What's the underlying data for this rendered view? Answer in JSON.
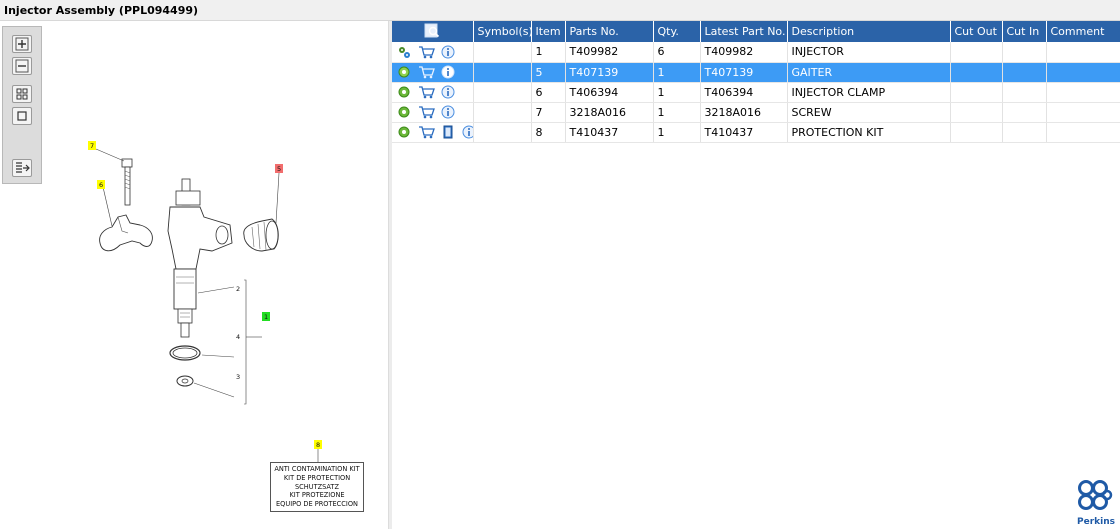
{
  "title": "Injector Assembly (PPL094499)",
  "toolbar": {
    "zoom_in": "zoom-in-icon",
    "zoom_out": "zoom-out-icon",
    "fit_all": "fit-all-icon",
    "actual_size": "actual-size-icon",
    "list_export": "list-export-icon"
  },
  "drawing": {
    "callouts": {
      "c7": "7",
      "c6": "6",
      "c5": "5",
      "c1": "1",
      "c2": "2",
      "c4": "4",
      "c3": "3",
      "c8": "8"
    },
    "kit_label": [
      "ANTI CONTAMINATION KIT",
      "KIT DE PROTECTION",
      "SCHUTZSATZ",
      "KIT PROTEZIONE",
      "EQUIPO DE PROTECCION"
    ]
  },
  "table": {
    "columns": {
      "icon": "search-list-icon",
      "symbols": "Symbol(s)",
      "item": "Item",
      "parts_no": "Parts No.",
      "qty": "Qty.",
      "latest_part_no": "Latest Part No.",
      "description": "Description",
      "cut_out": "Cut Out",
      "cut_in": "Cut In",
      "comment": "Comment"
    },
    "rows": [
      {
        "item": "1",
        "parts_no": "T409982",
        "qty": "6",
        "latest_part_no": "T409982",
        "description": "INJECTOR",
        "cut_out": "",
        "cut_in": "",
        "comment": "",
        "symbols": "",
        "icons": [
          "gears-icon",
          "cart-icon",
          "info-icon"
        ]
      },
      {
        "item": "5",
        "parts_no": "T407139",
        "qty": "1",
        "latest_part_no": "T407139",
        "description": "GAITER",
        "cut_out": "",
        "cut_in": "",
        "comment": "",
        "symbols": "",
        "icons": [
          "gear-icon",
          "cart-icon",
          "info-icon"
        ]
      },
      {
        "item": "6",
        "parts_no": "T406394",
        "qty": "1",
        "latest_part_no": "T406394",
        "description": "INJECTOR CLAMP",
        "cut_out": "",
        "cut_in": "",
        "comment": "",
        "symbols": "",
        "icons": [
          "gear-icon",
          "cart-icon",
          "info-icon"
        ]
      },
      {
        "item": "7",
        "parts_no": "3218A016",
        "qty": "1",
        "latest_part_no": "3218A016",
        "description": "SCREW",
        "cut_out": "",
        "cut_in": "",
        "comment": "",
        "symbols": "",
        "icons": [
          "gear-icon",
          "cart-icon",
          "info-icon"
        ]
      },
      {
        "item": "8",
        "parts_no": "T410437",
        "qty": "1",
        "latest_part_no": "T410437",
        "description": "PROTECTION KIT",
        "cut_out": "",
        "cut_in": "",
        "comment": "",
        "symbols": "",
        "icons": [
          "gear-icon",
          "cart-icon",
          "book-icon",
          "info-icon"
        ]
      }
    ],
    "selected_row_index": 1
  },
  "logo": {
    "text": "Perkins"
  },
  "colors": {
    "header_blue": "#2b63a8",
    "selected_row": "#3d9bf5",
    "callout_yellow": "#ffff00",
    "callout_green": "#22dd22",
    "callout_red": "#f26d6d",
    "brand_blue": "#1f5aa6"
  }
}
